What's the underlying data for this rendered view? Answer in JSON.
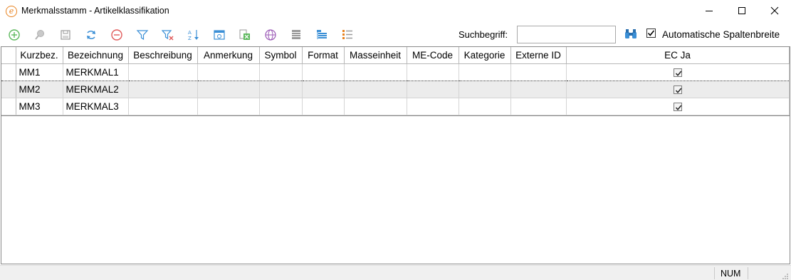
{
  "window": {
    "title": "Merkmalsstamm - Artikelklassifikation",
    "logo_icon": "e-logo-icon"
  },
  "toolbar": {
    "icons": [
      "add-icon",
      "search-icon",
      "save-icon",
      "refresh-icon",
      "delete-icon",
      "filter-icon",
      "clear-filter-icon",
      "sort-icon",
      "preview-icon",
      "excel-export-icon",
      "globe-icon",
      "print-icon",
      "columns-icon",
      "list-icon"
    ],
    "search_label": "Suchbegriff:",
    "search_value": "",
    "auto_width_label": "Automatische Spaltenbreite",
    "auto_width_checked": true
  },
  "grid": {
    "columns": [
      "Kurzbez.",
      "Bezeichnung",
      "Beschreibung",
      "Anmerkung",
      "Symbol",
      "Format",
      "Masseinheit",
      "ME-Code",
      "Kategorie",
      "Externe ID",
      "EC Ja"
    ],
    "rows": [
      {
        "kurzbez": "MM1",
        "bezeichnung": "MERKMAL1",
        "ec_ja": true
      },
      {
        "kurzbez": "MM2",
        "bezeichnung": "MERKMAL2",
        "ec_ja": true
      },
      {
        "kurzbez": "MM3",
        "bezeichnung": "MERKMAL3",
        "ec_ja": true
      }
    ]
  },
  "status": {
    "num": "NUM"
  },
  "colors": {
    "accent_orange": "#e8821e",
    "icon_green": "#5cb85c",
    "icon_blue": "#3b8fd6",
    "icon_red": "#e05a5a",
    "icon_purple": "#9b59b6"
  }
}
